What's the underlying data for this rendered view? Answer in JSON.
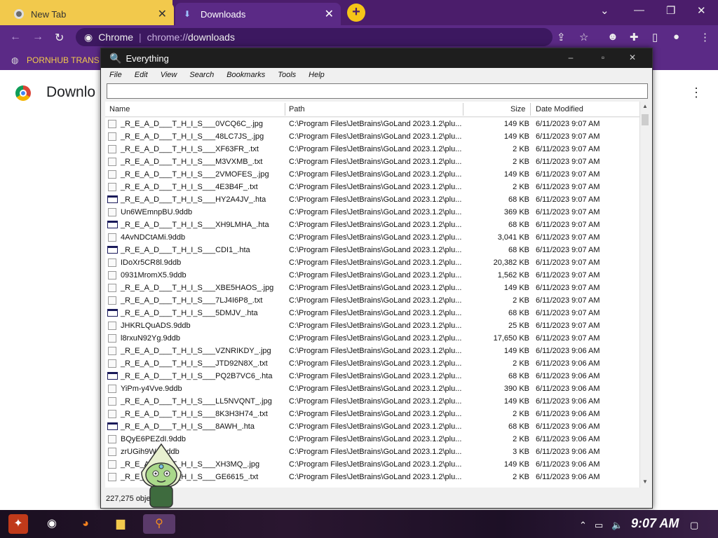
{
  "browser": {
    "tabs": [
      {
        "label": "New Tab"
      },
      {
        "label": "Downloads"
      }
    ],
    "omnibox": {
      "site": "Chrome",
      "url_prefix": "chrome://",
      "url_path": "downloads"
    },
    "bookmark": "PORNHUB TRANS",
    "page_title": "Downlo"
  },
  "everything": {
    "title": "Everything",
    "menu": [
      "File",
      "Edit",
      "View",
      "Search",
      "Bookmarks",
      "Tools",
      "Help"
    ],
    "search_value": "",
    "columns": {
      "name": "Name",
      "path": "Path",
      "size": "Size",
      "date": "Date Modified"
    },
    "rows": [
      {
        "icon": "image-file",
        "name": "_R_E_A_D___T_H_I_S___0VCQ6C_.jpg",
        "path": "C:\\Program Files\\JetBrains\\GoLand 2023.1.2\\plu...",
        "size": "149 KB",
        "date": "6/11/2023 9:07 AM"
      },
      {
        "icon": "image-file",
        "name": "_R_E_A_D___T_H_I_S___48LC7JS_.jpg",
        "path": "C:\\Program Files\\JetBrains\\GoLand 2023.1.2\\plu...",
        "size": "149 KB",
        "date": "6/11/2023 9:07 AM"
      },
      {
        "icon": "text-file",
        "name": "_R_E_A_D___T_H_I_S___XF63FR_.txt",
        "path": "C:\\Program Files\\JetBrains\\GoLand 2023.1.2\\plu...",
        "size": "2 KB",
        "date": "6/11/2023 9:07 AM"
      },
      {
        "icon": "text-file",
        "name": "_R_E_A_D___T_H_I_S___M3VXMB_.txt",
        "path": "C:\\Program Files\\JetBrains\\GoLand 2023.1.2\\plu...",
        "size": "2 KB",
        "date": "6/11/2023 9:07 AM"
      },
      {
        "icon": "image-file",
        "name": "_R_E_A_D___T_H_I_S___2VMOFES_.jpg",
        "path": "C:\\Program Files\\JetBrains\\GoLand 2023.1.2\\plu...",
        "size": "149 KB",
        "date": "6/11/2023 9:07 AM"
      },
      {
        "icon": "text-file",
        "name": "_R_E_A_D___T_H_I_S___4E3B4F_.txt",
        "path": "C:\\Program Files\\JetBrains\\GoLand 2023.1.2\\plu...",
        "size": "2 KB",
        "date": "6/11/2023 9:07 AM"
      },
      {
        "icon": "hta-file",
        "name": "_R_E_A_D___T_H_I_S___HY2A4JV_.hta",
        "path": "C:\\Program Files\\JetBrains\\GoLand 2023.1.2\\plu...",
        "size": "68 KB",
        "date": "6/11/2023 9:07 AM"
      },
      {
        "icon": "blank-file",
        "name": "Un6WEmnpBU.9ddb",
        "path": "C:\\Program Files\\JetBrains\\GoLand 2023.1.2\\plu...",
        "size": "369 KB",
        "date": "6/11/2023 9:07 AM"
      },
      {
        "icon": "hta-file",
        "name": "_R_E_A_D___T_H_I_S___XH9LMHA_.hta",
        "path": "C:\\Program Files\\JetBrains\\GoLand 2023.1.2\\plu...",
        "size": "68 KB",
        "date": "6/11/2023 9:07 AM"
      },
      {
        "icon": "blank-file",
        "name": "4AvNDCtAMi.9ddb",
        "path": "C:\\Program Files\\JetBrains\\GoLand 2023.1.2\\plu...",
        "size": "3,041 KB",
        "date": "6/11/2023 9:07 AM"
      },
      {
        "icon": "hta-file",
        "name": "_R_E_A_D___T_H_I_S___CDI1_.hta",
        "path": "C:\\Program Files\\JetBrains\\GoLand 2023.1.2\\plu...",
        "size": "68 KB",
        "date": "6/11/2023 9:07 AM"
      },
      {
        "icon": "blank-file",
        "name": "IDoXr5CR8l.9ddb",
        "path": "C:\\Program Files\\JetBrains\\GoLand 2023.1.2\\plu...",
        "size": "20,382 KB",
        "date": "6/11/2023 9:07 AM"
      },
      {
        "icon": "blank-file",
        "name": "0931MromX5.9ddb",
        "path": "C:\\Program Files\\JetBrains\\GoLand 2023.1.2\\plu...",
        "size": "1,562 KB",
        "date": "6/11/2023 9:07 AM"
      },
      {
        "icon": "image-file",
        "name": "_R_E_A_D___T_H_I_S___XBE5HAOS_.jpg",
        "path": "C:\\Program Files\\JetBrains\\GoLand 2023.1.2\\plu...",
        "size": "149 KB",
        "date": "6/11/2023 9:07 AM"
      },
      {
        "icon": "text-file",
        "name": "_R_E_A_D___T_H_I_S___7LJ4I6P8_.txt",
        "path": "C:\\Program Files\\JetBrains\\GoLand 2023.1.2\\plu...",
        "size": "2 KB",
        "date": "6/11/2023 9:07 AM"
      },
      {
        "icon": "hta-file",
        "name": "_R_E_A_D___T_H_I_S___5DMJV_.hta",
        "path": "C:\\Program Files\\JetBrains\\GoLand 2023.1.2\\plu...",
        "size": "68 KB",
        "date": "6/11/2023 9:07 AM"
      },
      {
        "icon": "blank-file",
        "name": "JHKRLQuADS.9ddb",
        "path": "C:\\Program Files\\JetBrains\\GoLand 2023.1.2\\plu...",
        "size": "25 KB",
        "date": "6/11/2023 9:07 AM"
      },
      {
        "icon": "blank-file",
        "name": "l8rxuN92Yg.9ddb",
        "path": "C:\\Program Files\\JetBrains\\GoLand 2023.1.2\\plu...",
        "size": "17,650 KB",
        "date": "6/11/2023 9:07 AM"
      },
      {
        "icon": "image-file",
        "name": "_R_E_A_D___T_H_I_S___VZNRIKDY_.jpg",
        "path": "C:\\Program Files\\JetBrains\\GoLand 2023.1.2\\plu...",
        "size": "149 KB",
        "date": "6/11/2023 9:06 AM"
      },
      {
        "icon": "text-file",
        "name": "_R_E_A_D___T_H_I_S___JTD92N8X_.txt",
        "path": "C:\\Program Files\\JetBrains\\GoLand 2023.1.2\\plu...",
        "size": "2 KB",
        "date": "6/11/2023 9:06 AM"
      },
      {
        "icon": "hta-file",
        "name": "_R_E_A_D___T_H_I_S___PQ2B7VC6_.hta",
        "path": "C:\\Program Files\\JetBrains\\GoLand 2023.1.2\\plu...",
        "size": "68 KB",
        "date": "6/11/2023 9:06 AM"
      },
      {
        "icon": "blank-file",
        "name": "YiPm-y4Vve.9ddb",
        "path": "C:\\Program Files\\JetBrains\\GoLand 2023.1.2\\plu...",
        "size": "390 KB",
        "date": "6/11/2023 9:06 AM"
      },
      {
        "icon": "image-file",
        "name": "_R_E_A_D___T_H_I_S___LL5NVQNT_.jpg",
        "path": "C:\\Program Files\\JetBrains\\GoLand 2023.1.2\\plu...",
        "size": "149 KB",
        "date": "6/11/2023 9:06 AM"
      },
      {
        "icon": "text-file",
        "name": "_R_E_A_D___T_H_I_S___8K3H3H74_.txt",
        "path": "C:\\Program Files\\JetBrains\\GoLand 2023.1.2\\plu...",
        "size": "2 KB",
        "date": "6/11/2023 9:06 AM"
      },
      {
        "icon": "hta-file",
        "name": "_R_E_A_D___T_H_I_S___8AWH_.hta",
        "path": "C:\\Program Files\\JetBrains\\GoLand 2023.1.2\\plu...",
        "size": "68 KB",
        "date": "6/11/2023 9:06 AM"
      },
      {
        "icon": "blank-file",
        "name": "BQyE6PEZdI.9ddb",
        "path": "C:\\Program Files\\JetBrains\\GoLand 2023.1.2\\plu...",
        "size": "2 KB",
        "date": "6/11/2023 9:06 AM"
      },
      {
        "icon": "blank-file",
        "name": "zrUGih9W...9ddb",
        "path": "C:\\Program Files\\JetBrains\\GoLand 2023.1.2\\plu...",
        "size": "3 KB",
        "date": "6/11/2023 9:06 AM"
      },
      {
        "icon": "image-file",
        "name": "_R_E_A_D___T_H_I_S___XH3MQ_.jpg",
        "path": "C:\\Program Files\\JetBrains\\GoLand 2023.1.2\\plu...",
        "size": "149 KB",
        "date": "6/11/2023 9:06 AM"
      },
      {
        "icon": "text-file",
        "name": "_R_E_A_D___T_H_I_S___GE6615_.txt",
        "path": "C:\\Program Files\\JetBrains\\GoLand 2023.1.2\\plu...",
        "size": "2 KB",
        "date": "6/11/2023 9:06 AM"
      }
    ],
    "status": "227,275 objects"
  },
  "taskbar": {
    "clock": "9:07 AM"
  }
}
